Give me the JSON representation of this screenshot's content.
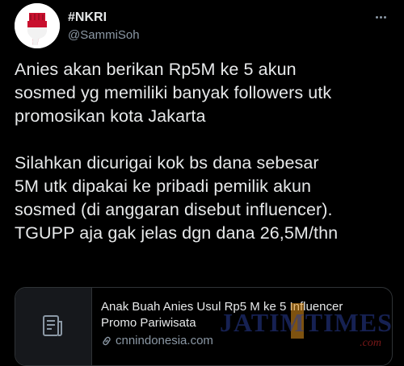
{
  "header": {
    "display_name": "#NKRI",
    "handle": "@SammiSoh",
    "avatar_icon": "raised-fist-flag-icon",
    "more_icon": "more-dots-icon"
  },
  "tweet": {
    "paragraphs": [
      {
        "lines": [
          "Anies akan berikan Rp5M ke 5 akun",
          "sosmed yg memiliki banyak followers utk",
          "promosikan kota Jakarta"
        ]
      },
      {
        "lines": [
          "Silahkan dicurigai kok bs dana sebesar",
          "5M utk dipakai ke pribadi pemilik akun",
          "sosmed (di anggaran disebut influencer).",
          "TGUPP aja gak jelas dgn dana 26,5M/thn"
        ]
      }
    ]
  },
  "link_card": {
    "thumbnail_icon": "article-icon",
    "title_lines": [
      "Anak Buah Anies Usul Rp5 M ke 5 Influencer",
      "Promo Pariwisata"
    ],
    "domain_icon": "link-icon",
    "domain": "cnnindonesia.com"
  },
  "watermark": {
    "text": "JATIMTIMES",
    "suffix": ".com"
  },
  "colors": {
    "background": "#000000",
    "text": "#e7e9ea",
    "secondary": "#8b98a5",
    "border": "#2f3336"
  }
}
